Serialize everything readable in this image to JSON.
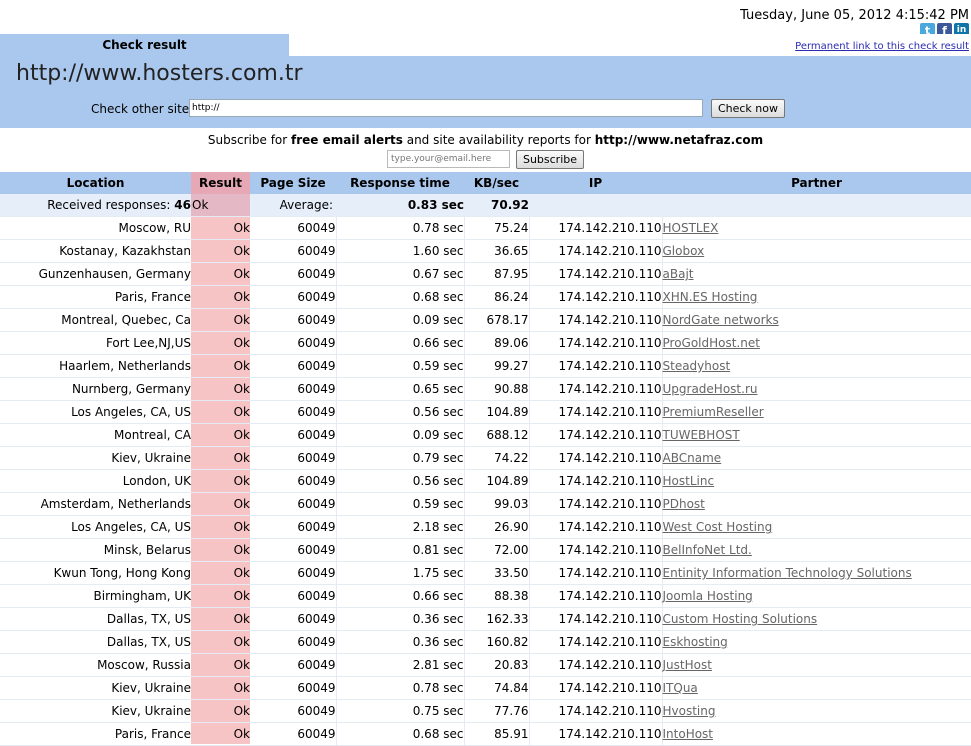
{
  "datetime": "Tuesday, June 05, 2012 4:15:42 PM",
  "social": [
    "twitter-icon",
    "facebook-icon",
    "linkedin-icon"
  ],
  "permalink": "Permanent link to this check result",
  "tab_title": "Check result",
  "site_url": "http://www.hosters.com.tr",
  "check_label": "Check other site:",
  "check_input_value": "http://",
  "check_button": "Check now",
  "subscribe": {
    "pre": "Subscribe for ",
    "bold1": "free email alerts",
    "mid": " and site availability reports for ",
    "bold2": "http://www.netafraz.com",
    "email_placeholder": "type.your@email.here",
    "button": "Subscribe"
  },
  "colors": {
    "header_bg": "#aac8ee",
    "result_col": "#f7c4c6",
    "summary_bg": "#e6eefa"
  },
  "table": {
    "headers": [
      "Location",
      "Result",
      "Page Size",
      "Response time",
      "KB/sec",
      "IP",
      "Partner"
    ],
    "summary": {
      "received_label": "Received responses:",
      "received_count": "46",
      "result": "Ok",
      "average_label": "Average:",
      "avg_time": "0.83 sec",
      "avg_kbs": "70.92"
    },
    "rows": [
      [
        "Moscow, RU",
        "Ok",
        "60049",
        "0.78 sec",
        "75.24",
        "174.142.210.110",
        "HOSTLEX"
      ],
      [
        "Kostanay, Kazakhstan",
        "Ok",
        "60049",
        "1.60 sec",
        "36.65",
        "174.142.210.110",
        "Globox"
      ],
      [
        "Gunzenhausen, Germany",
        "Ok",
        "60049",
        "0.67 sec",
        "87.95",
        "174.142.210.110",
        "aBajt"
      ],
      [
        "Paris, France",
        "Ok",
        "60049",
        "0.68 sec",
        "86.24",
        "174.142.210.110",
        "XHN.ES Hosting"
      ],
      [
        "Montreal, Quebec, Ca",
        "Ok",
        "60049",
        "0.09 sec",
        "678.17",
        "174.142.210.110",
        "NordGate networks"
      ],
      [
        "Fort Lee,NJ,US",
        "Ok",
        "60049",
        "0.66 sec",
        "89.06",
        "174.142.210.110",
        "ProGoldHost.net"
      ],
      [
        "Haarlem, Netherlands",
        "Ok",
        "60049",
        "0.59 sec",
        "99.27",
        "174.142.210.110",
        "Steadyhost"
      ],
      [
        "Nurnberg, Germany",
        "Ok",
        "60049",
        "0.65 sec",
        "90.88",
        "174.142.210.110",
        "UpgradeHost.ru"
      ],
      [
        "Los Angeles, CA, US",
        "Ok",
        "60049",
        "0.56 sec",
        "104.89",
        "174.142.210.110",
        "PremiumReseller"
      ],
      [
        "Montreal, CA",
        "Ok",
        "60049",
        "0.09 sec",
        "688.12",
        "174.142.210.110",
        "TUWEBHOST"
      ],
      [
        "Kiev, Ukraine",
        "Ok",
        "60049",
        "0.79 sec",
        "74.22",
        "174.142.210.110",
        "ABCname"
      ],
      [
        "London, UK",
        "Ok",
        "60049",
        "0.56 sec",
        "104.89",
        "174.142.210.110",
        "HostLinc"
      ],
      [
        "Amsterdam, Netherlands",
        "Ok",
        "60049",
        "0.59 sec",
        "99.03",
        "174.142.210.110",
        "PDhost"
      ],
      [
        "Los Angeles, CA, US",
        "Ok",
        "60049",
        "2.18 sec",
        "26.90",
        "174.142.210.110",
        "West Cost Hosting"
      ],
      [
        "Minsk, Belarus",
        "Ok",
        "60049",
        "0.81 sec",
        "72.00",
        "174.142.210.110",
        "BelInfoNet Ltd."
      ],
      [
        "Kwun Tong, Hong Kong",
        "Ok",
        "60049",
        "1.75 sec",
        "33.50",
        "174.142.210.110",
        "Entinity Information Technology Solutions"
      ],
      [
        "Birmingham, UK",
        "Ok",
        "60049",
        "0.66 sec",
        "88.38",
        "174.142.210.110",
        "Joomla Hosting"
      ],
      [
        "Dallas, TX, US",
        "Ok",
        "60049",
        "0.36 sec",
        "162.33",
        "174.142.210.110",
        "Custom Hosting Solutions"
      ],
      [
        "Dallas, TX, US",
        "Ok",
        "60049",
        "0.36 sec",
        "160.82",
        "174.142.210.110",
        "Eskhosting"
      ],
      [
        "Moscow, Russia",
        "Ok",
        "60049",
        "2.81 sec",
        "20.83",
        "174.142.210.110",
        "JustHost"
      ],
      [
        "Kiev, Ukraine",
        "Ok",
        "60049",
        "0.78 sec",
        "74.84",
        "174.142.210.110",
        "ITQua"
      ],
      [
        "Kiev, Ukraine",
        "Ok",
        "60049",
        "0.75 sec",
        "77.76",
        "174.142.210.110",
        "Hvosting"
      ],
      [
        "Paris, France",
        "Ok",
        "60049",
        "0.68 sec",
        "85.91",
        "174.142.210.110",
        "IntoHost"
      ]
    ]
  }
}
